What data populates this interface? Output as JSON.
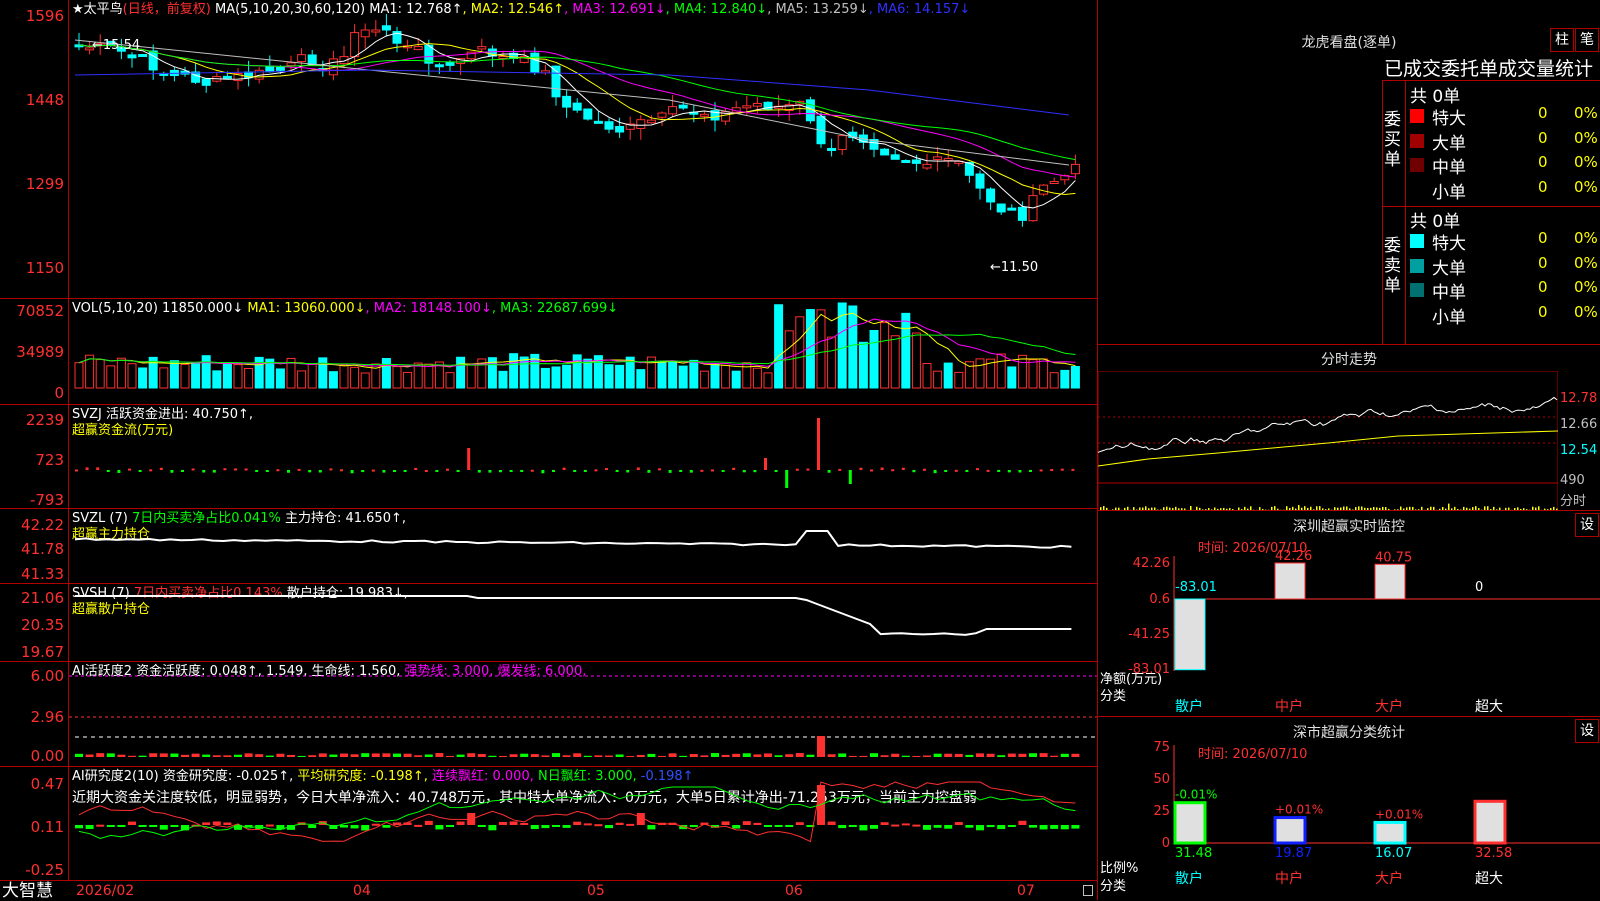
{
  "kline": {
    "title": "★太平鸟",
    "period": "(日线，前复权)",
    "ma_prefix": "MA(5,10,20,30,60,120)",
    "ma": [
      {
        "label": "MA1: 12.768↑",
        "color": "#ffffff"
      },
      {
        "label": "MA2: 12.546↑",
        "color": "#ffff00"
      },
      {
        "label": "MA3: 12.691↓",
        "color": "#ff00ff"
      },
      {
        "label": "MA4: 12.840↓",
        "color": "#00ff00"
      },
      {
        "label": "MA5: 13.259↓",
        "color": "#c0c0c0"
      },
      {
        "label": "MA6: 14.157↓",
        "color": "#3030ff"
      }
    ],
    "y_labels": [
      "1596",
      "1448",
      "1299",
      "1150"
    ],
    "high_label": "←15.54",
    "low_label": "←11.50"
  },
  "vol": {
    "header_prefix": "VOL(5,10,20)",
    "header_value": "11850.000↓",
    "ma": [
      {
        "label": "MA1: 13060.000↓",
        "color": "#ffff00"
      },
      {
        "label": "MA2: 18148.100↓",
        "color": "#ff00ff"
      },
      {
        "label": "MA3: 22687.699↓",
        "color": "#00ff00"
      }
    ],
    "y_labels": [
      "70852",
      "34989",
      "0"
    ]
  },
  "svzj": {
    "header": "SVZJ  活跃资金进出: 40.750↑,",
    "sub": "超赢资金流(万元)",
    "y_labels": [
      "2239",
      "723",
      "-793"
    ]
  },
  "svzl": {
    "header_a": "SVZL (7)",
    "header_b": "7日内买卖净占比0.041%",
    "header_c": "主力持仓: 41.650↑,",
    "sub": "超赢主力持仓",
    "y_labels": [
      "42.22",
      "41.78",
      "41.33"
    ]
  },
  "svsh": {
    "header_a": "SVSH (7)",
    "header_b": "7日内买卖净占比0.143%",
    "header_c": "散户持仓: 19.983↓,",
    "sub": "超赢散户持仓",
    "y_labels": [
      "21.06",
      "20.35",
      "19.67"
    ]
  },
  "ai_active": {
    "header_a": "AI活跃度2 资金活跃度: 0.048↑, 1.549, 生命线: 1.560,",
    "header_b": "强势线: 3.000, 爆发线: 6.000,",
    "y_labels": [
      "6.00",
      "2.96",
      "0.00"
    ]
  },
  "ai_research": {
    "header_a": "AI研究度2(10) 资金研究度: -0.025↑,",
    "header_b": "平均研究度: -0.198↑,",
    "header_c": "连续飘红: 0.000,",
    "header_d": "N日飘红: 3.000,",
    "header_e": "-0.198↑",
    "comment": "近期大资金关注度较低，明显弱势，今日大单净流入：40.748万元，其中特大单净流入：0万元，大单5日累计净出-71.253万元，当前主力控盘弱",
    "y_labels": [
      "0.47",
      "0.11",
      "-0.25"
    ]
  },
  "timeaxis": {
    "brand": "大智慧",
    "labels": [
      "2026/02",
      "04",
      "05",
      "06",
      "07"
    ]
  },
  "lhb": {
    "title": "龙虎看盘(逐单)",
    "btn1": "柱",
    "btn2": "笔",
    "subtitle": "已成交委托单成交量统计",
    "buy_label": "委买单",
    "sell_label": "委卖单",
    "buy_total": "共 0单",
    "sell_total": "共 0单",
    "buy_rows": [
      {
        "label": "特大",
        "value": "0",
        "pct": "0%",
        "color": "#ff0000"
      },
      {
        "label": "大单",
        "value": "0",
        "pct": "0%",
        "color": "#a00000"
      },
      {
        "label": "中单",
        "value": "0",
        "pct": "0%",
        "color": "#700000"
      },
      {
        "label": "小单",
        "value": "0",
        "pct": "0%",
        "color": "#000000"
      }
    ],
    "sell_rows": [
      {
        "label": "特大",
        "value": "0",
        "pct": "0%",
        "color": "#00ffff"
      },
      {
        "label": "大单",
        "value": "0",
        "pct": "0%",
        "color": "#00a0a0"
      },
      {
        "label": "中单",
        "value": "0",
        "pct": "0%",
        "color": "#007070"
      },
      {
        "label": "小单",
        "value": "0",
        "pct": "0%",
        "color": "#000000"
      }
    ]
  },
  "fenshi": {
    "title": "分时走势",
    "y_labels": [
      "12.78",
      "12.66",
      "12.54"
    ],
    "vol_label": "490",
    "footer": "分时"
  },
  "monitor": {
    "title": "深圳超赢实时监控",
    "btn": "设",
    "time": "时间: 2026/07/10",
    "y_labels": [
      "42.26",
      "0.6",
      "-41.25",
      "-83.01"
    ],
    "ylabel": "净额(万元)",
    "xlabel": "分类",
    "categories": [
      "散户",
      "中户",
      "大户",
      "超大"
    ],
    "values": [
      -83.01,
      42.26,
      40.75,
      0
    ],
    "value_labels": [
      "-83.01",
      "42.26",
      "40.75",
      "0"
    ]
  },
  "classify": {
    "title": "深市超赢分类统计",
    "btn": "设",
    "time": "时间: 2026/07/10",
    "y_labels": [
      "75",
      "50",
      "25",
      "0"
    ],
    "ylabel": "比例%",
    "xlabel": "分类",
    "categories": [
      "散户",
      "中户",
      "大户",
      "超大"
    ],
    "values": [
      31.48,
      19.87,
      16.07,
      32.58
    ],
    "value_labels": [
      "31.48",
      "19.87",
      "16.07",
      "32.58"
    ],
    "delta_labels": [
      "-0.01%",
      "+0.01%",
      "+0.01%",
      ""
    ]
  }
}
